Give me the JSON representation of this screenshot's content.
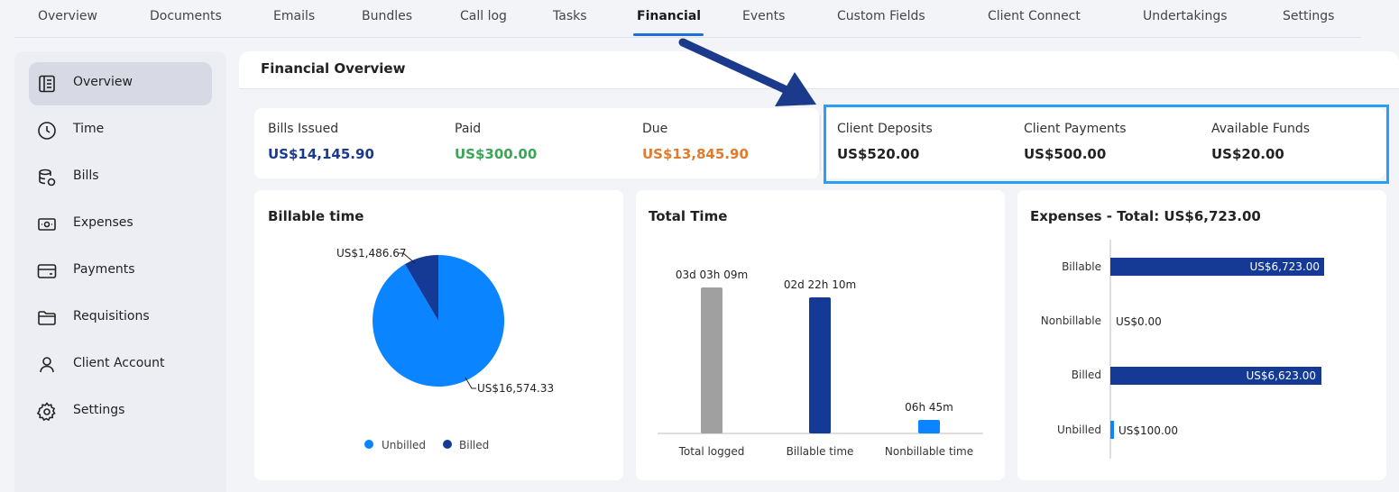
{
  "tabs": [
    {
      "label": "Overview"
    },
    {
      "label": "Documents"
    },
    {
      "label": "Emails"
    },
    {
      "label": "Bundles"
    },
    {
      "label": "Call log"
    },
    {
      "label": "Tasks"
    },
    {
      "label": "Financial",
      "active": true
    },
    {
      "label": "Events"
    },
    {
      "label": "Custom Fields"
    },
    {
      "label": "Client Connect"
    },
    {
      "label": "Undertakings"
    },
    {
      "label": "Settings"
    }
  ],
  "sidebar": {
    "items": [
      {
        "label": "Overview",
        "icon": "overview-icon",
        "active": true
      },
      {
        "label": "Time",
        "icon": "clock-icon"
      },
      {
        "label": "Bills",
        "icon": "bills-icon"
      },
      {
        "label": "Expenses",
        "icon": "banknote-icon"
      },
      {
        "label": "Payments",
        "icon": "credit-card-icon"
      },
      {
        "label": "Requisitions",
        "icon": "folder-icon"
      },
      {
        "label": "Client Account",
        "icon": "user-icon"
      },
      {
        "label": "Settings",
        "icon": "gear-icon"
      }
    ]
  },
  "panel": {
    "title": "Financial Overview"
  },
  "summary": {
    "bills_issued": {
      "label": "Bills Issued",
      "value": "US$14,145.90",
      "color": "#1a3a8f"
    },
    "paid": {
      "label": "Paid",
      "value": "US$300.00",
      "color": "#3aa757"
    },
    "due": {
      "label": "Due",
      "value": "US$13,845.90",
      "color": "#e07b2e"
    },
    "client_deposits": {
      "label": "Client Deposits",
      "value": "US$520.00"
    },
    "client_payments": {
      "label": "Client Payments",
      "value": "US$500.00"
    },
    "available_funds": {
      "label": "Available Funds",
      "value": "US$20.00"
    }
  },
  "colors": {
    "primary": "#0a84ff",
    "navy": "#143a96",
    "grey_bar": "#a0a0a0",
    "highlight": "#2a9df4",
    "arrow": "#1b3a8c"
  },
  "charts": {
    "billable_time": {
      "title": "Billable time",
      "chart_data": {
        "type": "pie",
        "slices": [
          {
            "name": "Unbilled",
            "value": 16574.33,
            "label": "US$16,574.33"
          },
          {
            "name": "Billed",
            "value": 1486.67,
            "label": "US$1,486.67"
          }
        ],
        "legend": [
          "Unbilled",
          "Billed"
        ]
      }
    },
    "total_time": {
      "title": "Total Time",
      "chart_data": {
        "type": "bar",
        "categories": [
          "Total logged",
          "Billable time",
          "Nonbillable time"
        ],
        "values_minutes": [
          4509,
          4210,
          405
        ],
        "labels": [
          "03d 03h 09m",
          "02d 22h 10m",
          "06h 45m"
        ]
      }
    },
    "expenses": {
      "title": "Expenses - Total: US$6,723.00",
      "chart_data": {
        "type": "bar",
        "orientation": "horizontal",
        "categories": [
          "Billable",
          "Nonbillable",
          "Billed",
          "Unbilled"
        ],
        "values": [
          6723.0,
          0.0,
          6623.0,
          100.0
        ],
        "labels": [
          "US$6,723.00",
          "US$0.00",
          "US$6,623.00",
          "US$100.00"
        ]
      }
    }
  }
}
